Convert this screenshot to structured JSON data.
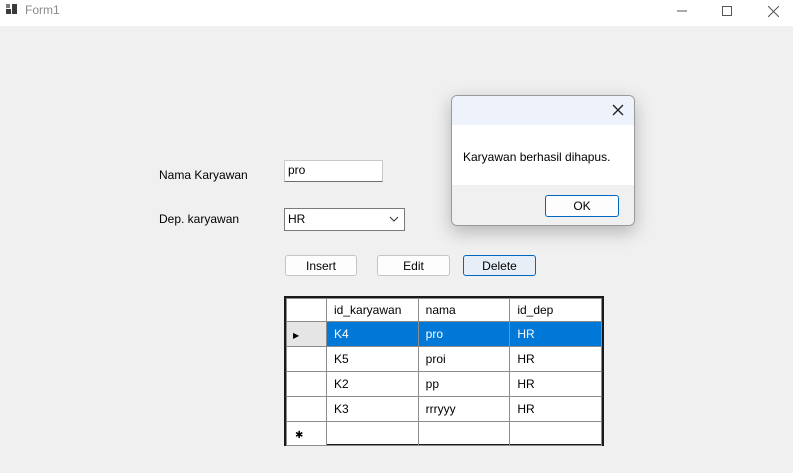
{
  "window": {
    "title": "Form1",
    "icon": "app-grid-icon",
    "controls": {
      "minimize": "minimize-icon",
      "maximize": "maximize-icon",
      "close": "close-icon"
    }
  },
  "form": {
    "name_label": "Nama Karyawan",
    "name_value": "pro",
    "dept_label": "Dep. karyawan",
    "dept_value": "HR",
    "buttons": {
      "insert": "Insert",
      "edit": "Edit",
      "delete": "Delete"
    }
  },
  "grid": {
    "columns": [
      "id_karyawan",
      "nama",
      "id_dep"
    ],
    "rows": [
      {
        "id_karyawan": "K4",
        "nama": "pro",
        "id_dep": "HR"
      },
      {
        "id_karyawan": "K5",
        "nama": "proi",
        "id_dep": "HR"
      },
      {
        "id_karyawan": "K2",
        "nama": "pp",
        "id_dep": "HR"
      },
      {
        "id_karyawan": "K3",
        "nama": "rrryyy",
        "id_dep": "HR"
      }
    ],
    "current_row_marker": "▶",
    "new_row_marker": "✱"
  },
  "dialog": {
    "message": "Karyawan berhasil dihapus.",
    "ok_label": "OK"
  },
  "colors": {
    "selection": "#0078d7",
    "accent_border": "#0067c0"
  }
}
